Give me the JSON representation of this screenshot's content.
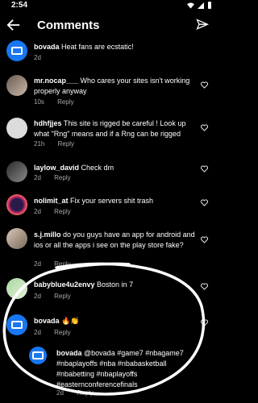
{
  "status": {
    "time": "2:54"
  },
  "header": {
    "title": "Comments"
  },
  "comments": [
    {
      "user": "bovada",
      "text": "Heat fans are ecstatic!",
      "time": "2d",
      "reply": ""
    },
    {
      "user": "mr.nocap___",
      "text": "Who cares your sites isn't working properly anyway",
      "time": "10s",
      "reply": "Reply"
    },
    {
      "user": "hdhfjjes",
      "text": "This site is rigged be careful ! Look up what \"Rng\" means and if a Rng can be rigged",
      "time": "21h",
      "reply": "Reply"
    },
    {
      "user": "laylow_david",
      "text": "Check dm",
      "time": "2d",
      "reply": "Reply"
    },
    {
      "user": "nolimit_at",
      "text": "Fix your servers shit trash",
      "time": "2d",
      "reply": "Reply"
    },
    {
      "user": "s.j.millo",
      "text": "do you guys have an app for android and ios or all the apps i see on the play store fake?",
      "time": "2d",
      "reply": "Reply"
    },
    {
      "user": "babyblue4u2envy",
      "text": "Boston in 7",
      "time": "2d",
      "reply": "Reply"
    },
    {
      "user": "bovada",
      "text": "🔥👏",
      "time": "2d",
      "reply": "Reply"
    }
  ],
  "nested_reply": {
    "user": "bovada",
    "text": "@bovada #game7 #nbagame7 #nbaplayoffs #nba #nbabasketball #nbabetting #nbaplayoffs #easternconferencefinals",
    "time": "2d",
    "reply": "Reply"
  },
  "colors": {
    "background": "#000000",
    "meta": "#a8a8a8",
    "bovada_avatar": "#1877f2",
    "annotation": "#ffffff"
  }
}
